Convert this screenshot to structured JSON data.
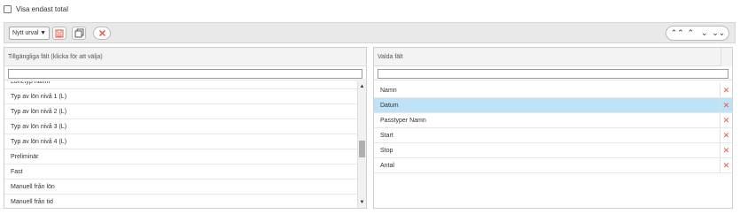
{
  "top": {
    "show_total_label": "Visa endast total"
  },
  "toolbar": {
    "selection_value": "Nytt urval",
    "save_icon": "save-icon",
    "copy_icon": "copy-icon",
    "clear_icon": "close-icon",
    "nav_icons": [
      "double-chevron-up-icon",
      "chevron-up-icon",
      "chevron-down-icon",
      "double-chevron-down-icon"
    ]
  },
  "available": {
    "header": "Tillgängliga fält (klicka för att välja)",
    "items": [
      "Lönetyp namn",
      "Typ av lön nivå 1 (L)",
      "Typ av lön nivå 2 (L)",
      "Typ av lön nivå 3 (L)",
      "Typ av lön nivå 4 (L)",
      "Preliminär",
      "Fast",
      "Manuell från lön",
      "Manuell från tid"
    ]
  },
  "selected": {
    "header": "Valda fält",
    "items": [
      "Namn",
      "Datum",
      "Passtyper Namn",
      "Start",
      "Stop",
      "Antal"
    ],
    "selected_index": 1
  },
  "colors": {
    "accent_remove": "#e8553c",
    "selected_row": "#bfe3f6"
  }
}
